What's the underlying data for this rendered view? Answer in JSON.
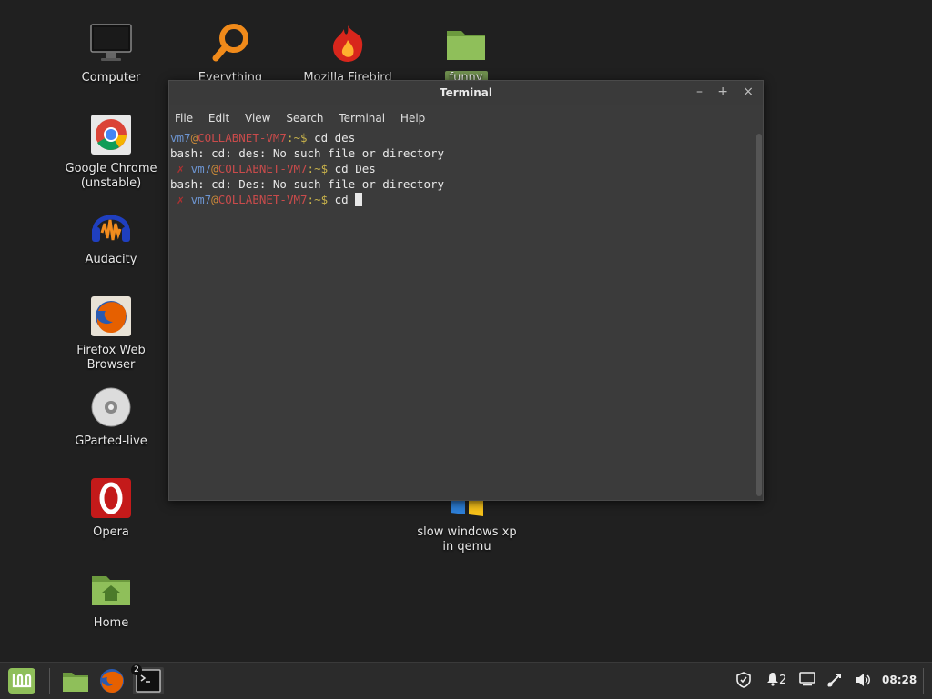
{
  "desktop": {
    "icons": [
      {
        "id": "computer",
        "label": "Computer"
      },
      {
        "id": "everything",
        "label": "Everything"
      },
      {
        "id": "firebird",
        "label": "Mozilla Firebird"
      },
      {
        "id": "funny",
        "label": "funny"
      },
      {
        "id": "chrome",
        "label": "Google Chrome\n(unstable)"
      },
      {
        "id": "audacity",
        "label": "Audacity"
      },
      {
        "id": "firefox",
        "label": "Firefox Web\nBrowser"
      },
      {
        "id": "gparted",
        "label": "GParted-live"
      },
      {
        "id": "opera",
        "label": "Opera"
      },
      {
        "id": "home",
        "label": "Home"
      },
      {
        "id": "winxp",
        "label": "slow windows xp\nin qemu"
      }
    ]
  },
  "terminal": {
    "title": "Terminal",
    "controls": {
      "minimize": "–",
      "maximize": "+",
      "close": "×"
    },
    "menu": [
      "File",
      "Edit",
      "View",
      "Search",
      "Terminal",
      "Help"
    ],
    "prompt": {
      "user": "vm7",
      "at": "@",
      "host": "COLLABNET-VM7",
      "sep": ":",
      "path": "~",
      "dollar": "$"
    },
    "lines": [
      {
        "type": "prompt",
        "mark": "",
        "cmd": " cd des"
      },
      {
        "type": "output",
        "text": "bash: cd: des: No such file or directory"
      },
      {
        "type": "prompt",
        "mark": " ✗ ",
        "cmd": " cd Des"
      },
      {
        "type": "output",
        "text": "bash: cd: Des: No such file or directory"
      },
      {
        "type": "prompt",
        "mark": " ✗ ",
        "cmd": " cd "
      }
    ]
  },
  "taskbar": {
    "clock": "08:28",
    "notifications": "2",
    "terminal_badge": "2"
  },
  "colors": {
    "accent": "#8fbf5a",
    "desktop": "#202020",
    "panel": "#2b2b2b"
  }
}
